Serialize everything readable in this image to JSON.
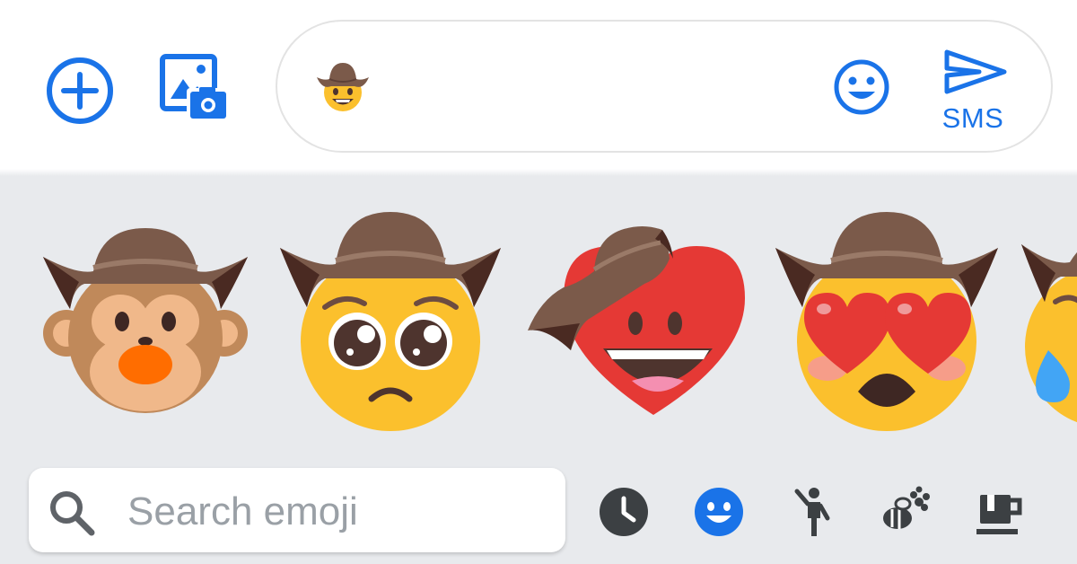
{
  "toolbar": {
    "attach_icon": "plus-circle-icon",
    "gallery_icon": "image-camera-icon"
  },
  "compose": {
    "message_emoji": "cowboy-hat-face",
    "emoji_icon": "smiley-icon",
    "send_icon": "send-icon",
    "send_label": "SMS"
  },
  "emoji_kitchen": {
    "suggestions": [
      "cowboy-hat-monkey",
      "cowboy-hat-pleading-face",
      "cowboy-hat-heart-face",
      "cowboy-hat-heart-eyes-face",
      "cowboy-hat-crying-face"
    ]
  },
  "search": {
    "placeholder": "Search emoji",
    "icon": "search-icon"
  },
  "categories": [
    {
      "name": "recent",
      "icon": "clock-icon",
      "selected": false
    },
    {
      "name": "smileys",
      "icon": "smiley-icon",
      "selected": true
    },
    {
      "name": "people",
      "icon": "person-walking-icon",
      "selected": false
    },
    {
      "name": "animals-nature",
      "icon": "bee-flower-icon",
      "selected": false
    },
    {
      "name": "food",
      "icon": "coffee-cup-icon",
      "selected": false
    }
  ],
  "colors": {
    "accent": "#1a73e8",
    "panel_bg": "#e8eaed",
    "hat": "#7b5a4a",
    "hat_dark": "#4a2a22",
    "face": "#fbc02d",
    "heart": "#e53935",
    "icon_dark": "#3c4043"
  }
}
